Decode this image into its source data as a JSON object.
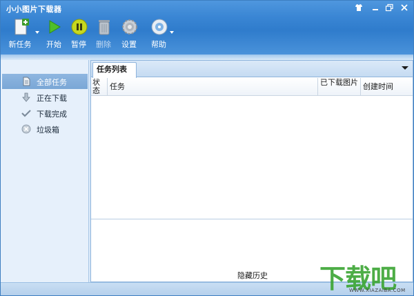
{
  "window": {
    "title": "小小图片下载器",
    "controls": [
      "shirt-icon",
      "minimize-icon",
      "maximize-icon",
      "close-icon"
    ]
  },
  "toolbar": {
    "new_task": "新任务",
    "start": "开始",
    "pause": "暂停",
    "delete": "删除",
    "settings": "设置",
    "help": "帮助"
  },
  "sidebar": {
    "items": [
      {
        "label": "全部任务",
        "icon": "document-icon",
        "selected": true
      },
      {
        "label": "正在下载",
        "icon": "download-arrow-icon",
        "selected": false
      },
      {
        "label": "下载完成",
        "icon": "checkmark-icon",
        "selected": false
      },
      {
        "label": "垃圾箱",
        "icon": "trash-icon",
        "selected": false
      }
    ]
  },
  "main": {
    "tab_label": "任务列表",
    "columns": [
      "状态",
      "任务",
      "已下载图片",
      "创建时间"
    ],
    "rows": [],
    "history_label": "隐藏历史"
  },
  "watermark": {
    "text": "下载吧",
    "url": "WWW.XIAZAIBA.COM"
  },
  "colors": {
    "titlebar": "#3a86d4",
    "selected_nav": "#7aa7d6",
    "watermark_green": "#3aa532"
  }
}
